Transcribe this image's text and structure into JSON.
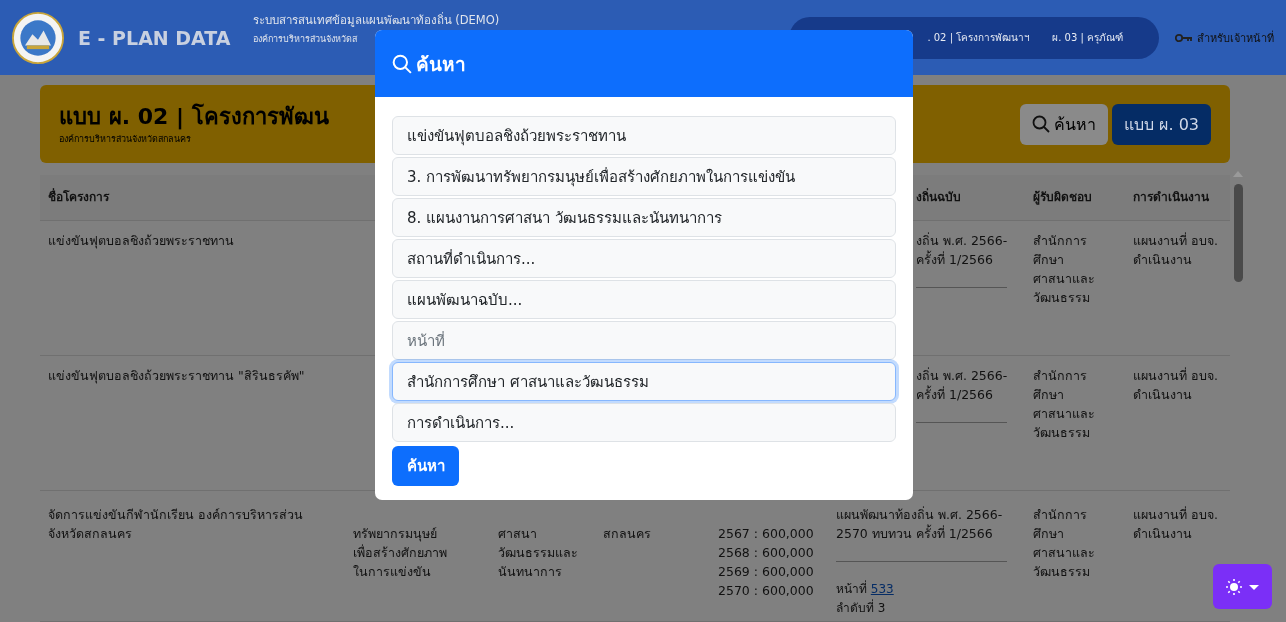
{
  "header": {
    "title": "E - PLAN DATA",
    "system": "ระบบสารสนเทศข้อมูลแผนพัฒนาท้องถิ่น (DEMO)",
    "org": "องค์การบริหารส่วนจังหวัดส",
    "nav": [
      ". 02 | โครงการพัฒนาฯ",
      "ผ. 03 | ครุภัณฑ์"
    ],
    "staff_link": "สำหรับเจ้าหน้าที่"
  },
  "banner": {
    "title": "แบบ ผ. 02 | โครงการพัฒน",
    "subtitle": "องค์การบริหารส่วนจังหวัดสกลนคร",
    "buttons": [
      {
        "label": "ค้นหา",
        "kind": "search"
      },
      {
        "label": "แบบ ผ. 03",
        "kind": "primary"
      }
    ]
  },
  "table": {
    "columns": [
      "ชื่อโครงการ",
      "งถิ่นฉบับ",
      "ผู้รับผิดชอบ",
      "การดำเนินงาน"
    ],
    "rows": [
      {
        "kind": "covered",
        "name": "แข่งขันฟุตบอลชิงถ้วยพระราชทาน",
        "plan": [
          "งถิ่น พ.ศ. 2566-",
          "ครั้งที่ 1/2566"
        ],
        "owner": [
          "สำนักการศึกษา",
          "ศาสนาและ",
          "วัฒนธรรม"
        ],
        "status": [
          "แผนงานที่ อบจ.",
          "ดำเนินงาน"
        ]
      },
      {
        "kind": "covered",
        "name": "แข่งขันฟุตบอลชิงถ้วยพระราชทาน \"สิรินธรคัพ\"",
        "plan": [
          "งถิ่น พ.ศ. 2566-",
          "ครั้งที่ 1/2566"
        ],
        "owner": [
          "สำนักการศึกษา",
          "ศาสนาและ",
          "วัฒนธรรม"
        ],
        "status": [
          "แผนงานที่ อบจ.",
          "ดำเนินงาน"
        ]
      },
      {
        "kind": "partial",
        "name": "จัดการแข่งขันกีฬานักเรียน องค์การบริหารส่วนจังหวัดสกลนคร",
        "strategy": [
          "ทรัพยากรมนุษย์",
          "เพื่อสร้างศักยภาพ",
          "ในการแข่งขัน"
        ],
        "plan_group": [
          "ศาสนา",
          "วัฒนธรรมและ",
          "นันทนาการ"
        ],
        "area": [
          "สกลนคร"
        ],
        "budget": [
          "2567 : 600,000",
          "2568 : 600,000",
          "2569 : 600,000",
          "2570 : 600,000"
        ],
        "plan": [
          "แผนพัฒนาท้องถิ่น พ.ศ. 2566-",
          "2570 ทบทวน ครั้งที่ 1/2566"
        ],
        "page_label": "หน้าที่",
        "page_link": "533",
        "order": "ลำดับที่ 3",
        "owner": [
          "สำนักการศึกษา",
          "ศาสนาและ",
          "วัฒนธรรม"
        ],
        "status": [
          "แผนงานที่ อบจ.",
          "ดำเนินงาน"
        ]
      }
    ]
  },
  "modal": {
    "title": "ค้นหา",
    "fields": [
      {
        "value": "แข่งขันฟุตบอลชิงถ้วยพระราชทาน",
        "focused": false
      },
      {
        "value": "3. การพัฒนาทรัพยากรมนุษย์เพื่อสร้างศักยภาพในการแข่งขัน",
        "focused": false
      },
      {
        "value": "8. แผนงานการศาสนา วัฒนธรรมและนันทนาการ",
        "focused": false
      },
      {
        "value": "สถานที่ดำเนินการ...",
        "focused": false
      },
      {
        "value": "แผนพัฒนาฉบับ...",
        "focused": false
      },
      {
        "placeholder": "หน้าที่",
        "focused": false
      },
      {
        "value": "สำนักการศึกษา ศาสนาและวัฒนธรรม",
        "focused": true
      },
      {
        "value": "การดำเนินการ...",
        "focused": false
      }
    ],
    "submit": "ค้นหา"
  }
}
